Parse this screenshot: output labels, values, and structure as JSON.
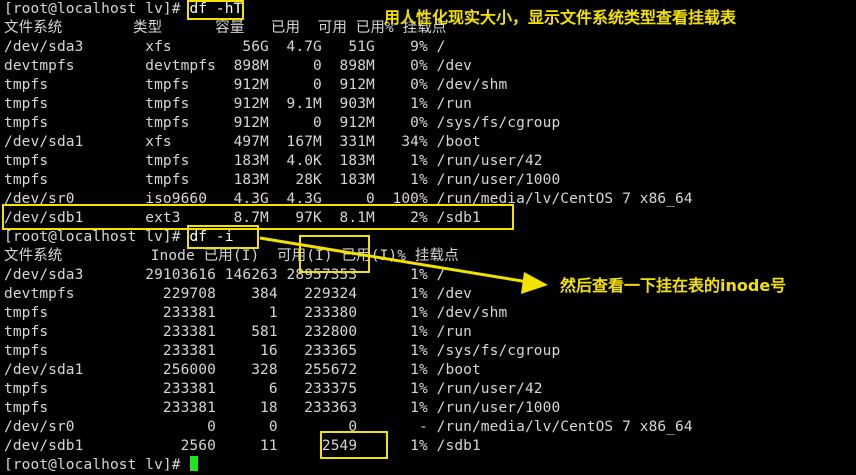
{
  "terminal": {
    "prompt_1": "[root@localhost lv]# ",
    "command_1": "df -hT",
    "table_1": {
      "header": "文件系统        类型      容量   已用  可用 已用% 挂载点",
      "rows": [
        "/dev/sda3       xfs        56G  4.7G   51G    9% /",
        "devtmpfs        devtmpfs  898M     0  898M    0% /dev",
        "tmpfs           tmpfs     912M     0  912M    0% /dev/shm",
        "tmpfs           tmpfs     912M  9.1M  903M    1% /run",
        "tmpfs           tmpfs     912M     0  912M    0% /sys/fs/cgroup",
        "/dev/sda1       xfs       497M  167M  331M   34% /boot",
        "tmpfs           tmpfs     183M  4.0K  183M    1% /run/user/42",
        "tmpfs           tmpfs     183M   28K  183M    1% /run/user/1000",
        "/dev/sr0        iso9660   4.3G  4.3G     0  100% /run/media/lv/CentOS 7 x86_64",
        "/dev/sdb1       ext3      8.7M   97K  8.1M    2% /sdb1"
      ]
    },
    "prompt_2": "[root@localhost lv]# ",
    "command_2": "df -i",
    "table_2": {
      "header": "文件系统          Inode 已用(I)  可用(I) 已用(I)% 挂载点",
      "rows": [
        "/dev/sda3       29103616 146263 28957353      1% /",
        "devtmpfs          229708    384   229324      1% /dev",
        "tmpfs             233381      1   233380      1% /dev/shm",
        "tmpfs             233381    581   232800      1% /run",
        "tmpfs             233381     16   233365      1% /sys/fs/cgroup",
        "/dev/sda1         256000    328   255672      1% /boot",
        "tmpfs             233381      6   233375      1% /run/user/42",
        "tmpfs             233381     18   233363      1% /run/user/1000",
        "/dev/sr0               0      0        0       - /run/media/lv/CentOS 7 x86_64",
        "/dev/sdb1           2560     11     2549      1% /sdb1"
      ]
    },
    "prompt_3": "[root@localhost lv]# "
  },
  "annotations": {
    "note_1": "用人性化现实大小，显示文件系统类型查看挂载表",
    "note_2": "然后查看一下挂在表的inode号",
    "highlight_color": "#f3e100"
  },
  "colors": {
    "background": "#000000",
    "text": "#d6d6d6",
    "cursor": "#1ee51e"
  }
}
